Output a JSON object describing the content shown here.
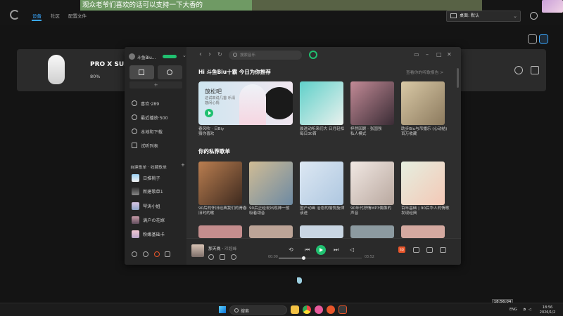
{
  "ghub": {
    "tabs": [
      "设备",
      "社区",
      "配置文件"
    ],
    "profile_label": "桌面: 默认",
    "device_name": "PRO X SUP",
    "battery": "80%"
  },
  "stream_banner": "观众老爷们喜欢的话可以支持一下大香的",
  "music": {
    "user_name": "斗鱼Biu...",
    "search_placeholder": "搜索音乐",
    "side_items": [
      "喜欢·289",
      "最近播放·500",
      "本地和下载",
      "试听列表"
    ],
    "playlist_header": "自建歌单 · 收藏歌单",
    "playlists": [
      "日推桃子",
      "新建歌单1",
      "琴涛小姐",
      "满户の花嫁",
      "粉嫩基础卡"
    ],
    "greeting": "Hi 斗鱼Biu十霸 今日为你推荐",
    "greeting_more": "查看你的听歌报告 >",
    "feature": {
      "title": "放松吧",
      "subtitle": "这试来说几首 乐清悠闲心情",
      "caption": [
        "春风吹 · 日Biy",
        "猜你喜欢"
      ]
    },
    "top_cards": [
      {
        "title": [
          "晨进动听来们大 日月轻松",
          "每日30首"
        ]
      },
      {
        "title": [
          "梓然回顾 · 张国强",
          "私人模式"
        ]
      },
      {
        "title": [
          "助步Biu与吊播乐 (心动结)",
          "百万收藏"
        ]
      }
    ],
    "section2": "你的私荐歌单",
    "rec_cards": [
      [
        "90后的怀旧经典我们的青春",
        "旧时的歌"
      ],
      [
        "90后正经说出现神一般",
        "吸着颂音"
      ],
      [
        "国产动画 治愈的愉悦旋律",
        "该进"
      ],
      [
        "90年代抒情MP3偶像的",
        "声音"
      ],
      [
        "百年基础 | 90后华人的情歌",
        "发现经典"
      ]
    ],
    "player": {
      "song": "那天晚 · ",
      "artist": "邓超峰",
      "time_current": "00:00",
      "time_total": "03:52",
      "progress": 0.3
    }
  },
  "taskbar": {
    "search": "搜索",
    "lang": "ENG",
    "time": "18:56",
    "date": "2026/1/2",
    "time_tip": "18:56:04"
  }
}
